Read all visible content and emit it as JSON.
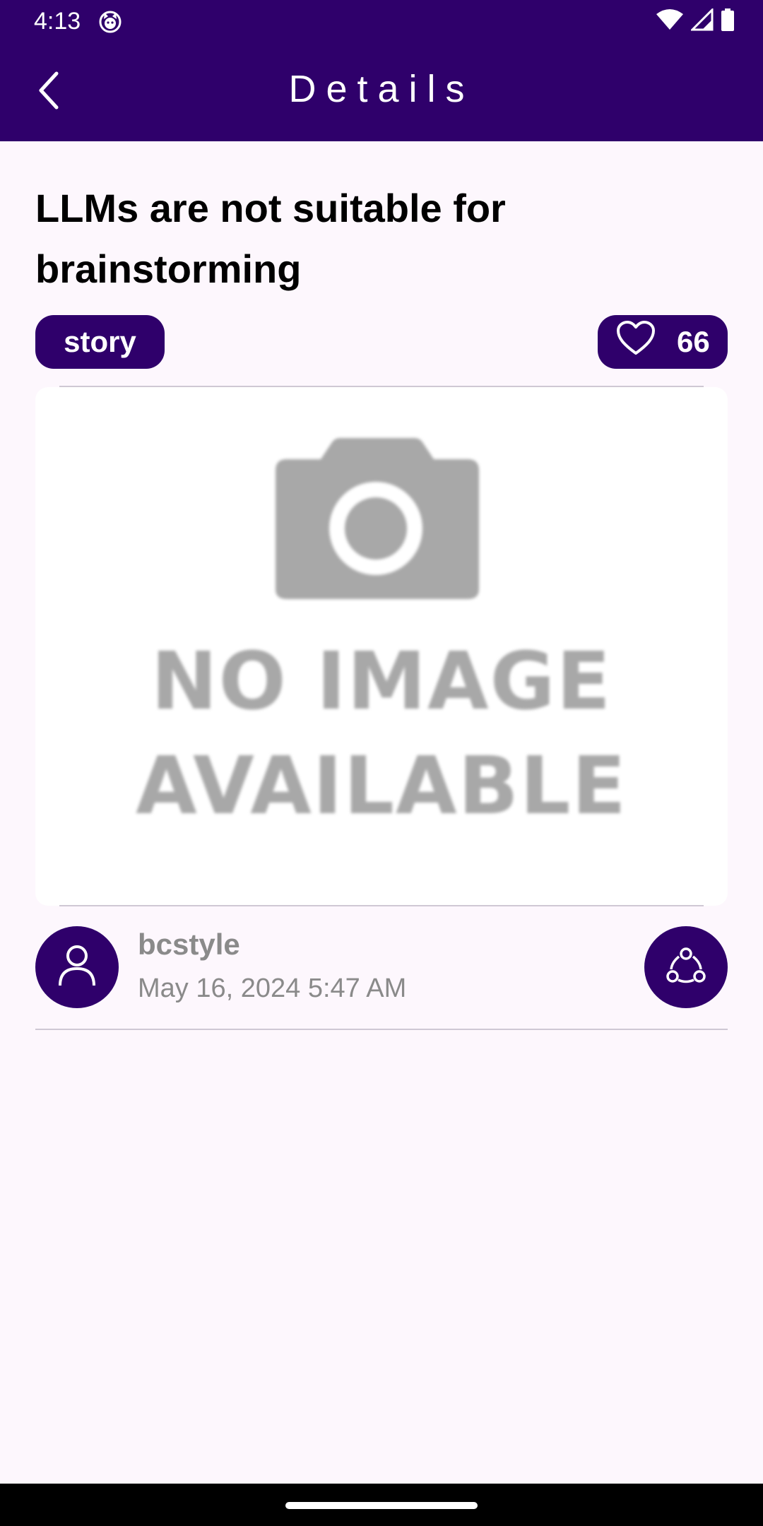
{
  "status_bar": {
    "time": "4:13",
    "icons": [
      "cat-icon",
      "wifi-icon",
      "signal-icon",
      "battery-icon"
    ]
  },
  "app_bar": {
    "title": "Details",
    "back_icon": "chevron-left-icon"
  },
  "post": {
    "title": "LLMs are not suitable for brainstorming",
    "tag": "story",
    "likes": "66",
    "like_icon": "heart-outline-icon",
    "image": {
      "line1": "NO IMAGE",
      "line2": "AVAILABLE",
      "icon": "camera-icon"
    },
    "author": "bcstyle",
    "date": "May 16, 2024 5:47 AM",
    "avatar_icon": "person-icon",
    "share_icon": "share-icon"
  },
  "colors": {
    "primary": "#2F006B",
    "background": "#FDF7FD",
    "muted_text": "#8A8A8A",
    "placeholder_gray": "#A8A8A8"
  }
}
